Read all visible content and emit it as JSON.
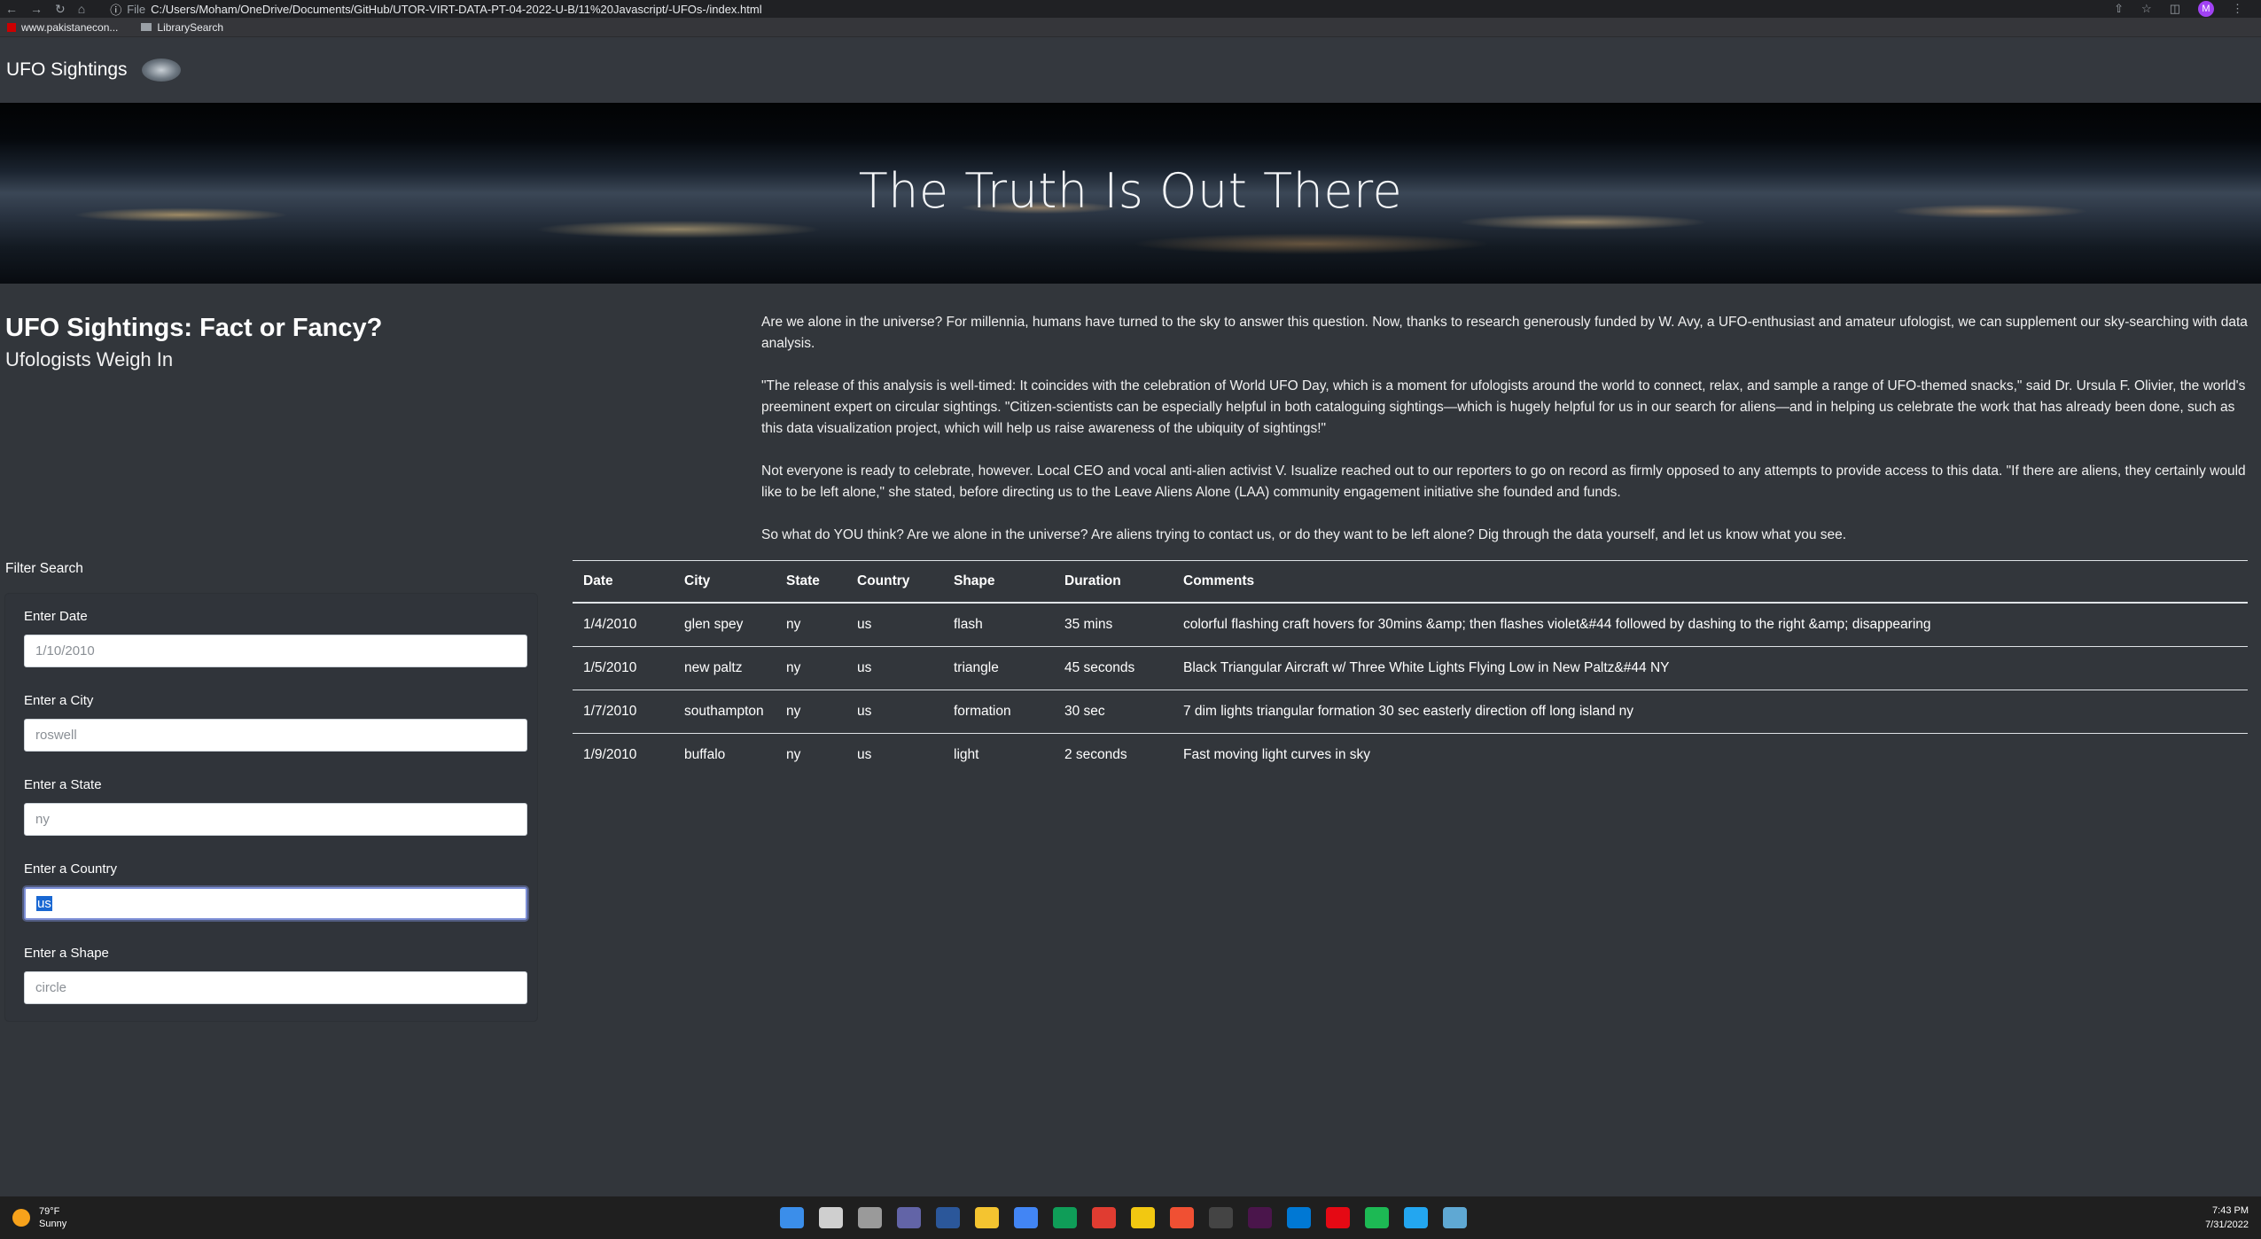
{
  "browser": {
    "file_label": "File",
    "url": "C:/Users/Moham/OneDrive/Documents/GitHub/UTOR-VIRT-DATA-PT-04-2022-U-B/11%20Javascript/-UFOs-/index.html",
    "avatar_letter": "M",
    "bookmarks": [
      "www.pakistanecon...",
      "LibrarySearch"
    ]
  },
  "navbar": {
    "brand": "UFO Sightings"
  },
  "hero": {
    "title": "The Truth Is Out There"
  },
  "intro": {
    "title": "UFO Sightings: Fact or Fancy?",
    "subtitle": "Ufologists Weigh In"
  },
  "article": {
    "paragraphs": [
      "Are we alone in the universe? For millennia, humans have turned to the sky to answer this question. Now, thanks to research generously funded by W. Avy, a UFO-enthusiast and amateur ufologist, we can supplement our sky-searching with data analysis.",
      "\"The release of this analysis is well-timed: It coincides with the celebration of World UFO Day, which is a moment for ufologists around the world to connect, relax, and sample a range of UFO-themed snacks,\" said Dr. Ursula F. Olivier, the world's preeminent expert on circular sightings. \"Citizen-scientists can be especially helpful in both cataloguing sightings—which is hugely helpful for us in our search for aliens—and in helping us celebrate the work that has already been done, such as this data visualization project, which will help us raise awareness of the ubiquity of sightings!\"",
      "Not everyone is ready to celebrate, however. Local CEO and vocal anti-alien activist V. Isualize reached out to our reporters to go on record as firmly opposed to any attempts to provide access to this data. \"If there are aliens, they certainly would like to be left alone,\" she stated, before directing us to the Leave Aliens Alone (LAA) community engagement initiative she founded and funds.",
      "So what do YOU think? Are we alone in the universe? Are aliens trying to contact us, or do they want to be left alone? Dig through the data yourself, and let us know what you see."
    ]
  },
  "filters": {
    "title": "Filter Search",
    "date": {
      "label": "Enter Date",
      "placeholder": "1/10/2010"
    },
    "city": {
      "label": "Enter a City",
      "placeholder": "roswell"
    },
    "state": {
      "label": "Enter a State",
      "placeholder": "ny"
    },
    "country": {
      "label": "Enter a Country",
      "value": "us"
    },
    "shape": {
      "label": "Enter a Shape",
      "placeholder": "circle"
    }
  },
  "table": {
    "headers": [
      "Date",
      "City",
      "State",
      "Country",
      "Shape",
      "Duration",
      "Comments"
    ],
    "rows": [
      [
        "1/4/2010",
        "glen spey",
        "ny",
        "us",
        "flash",
        "35 mins",
        "colorful flashing craft hovers for 30mins &amp; then flashes violet&#44 followed by dashing to the right &amp; disappearing"
      ],
      [
        "1/5/2010",
        "new paltz",
        "ny",
        "us",
        "triangle",
        "45 seconds",
        "Black Triangular Aircraft w/ Three White Lights Flying Low in New Paltz&#44 NY"
      ],
      [
        "1/7/2010",
        "southampton",
        "ny",
        "us",
        "formation",
        "30 sec",
        "7 dim lights triangular formation 30 sec easterly direction off long island ny"
      ],
      [
        "1/9/2010",
        "buffalo",
        "ny",
        "us",
        "light",
        "2 seconds",
        "Fast moving light curves in sky"
      ]
    ]
  },
  "taskbar": {
    "temp": "79°F",
    "condition": "Sunny",
    "time": "7:43 PM",
    "date": "7/31/2022",
    "icon_colors": [
      "#3b8eea",
      "#cfcfcf",
      "#9a9a9a",
      "#6264a7",
      "#2b579a",
      "#f4c430",
      "#4285f4",
      "#0f9d58",
      "#e03c31",
      "#f2c811",
      "#f05033",
      "#444444",
      "#4a154b",
      "#0078d4",
      "#e50914",
      "#1db954",
      "#23a6f0",
      "#5fa8d3"
    ]
  }
}
